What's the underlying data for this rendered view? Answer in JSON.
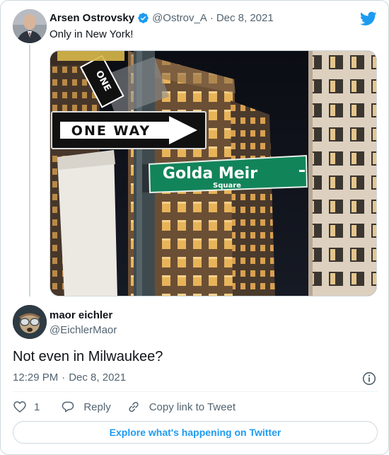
{
  "quoted_tweet": {
    "author_name": "Arsen Ostrovsky",
    "handle": "@Ostrov_A",
    "separator": "·",
    "date": "Dec 8, 2021",
    "text": "Only in New York!",
    "photo": {
      "sign_one_way": "ONE WAY",
      "sign_one_vertical": "ONE",
      "street_sign_main": "Golda Meir",
      "street_sign_sub": "Square"
    }
  },
  "reply_tweet": {
    "author_name": "maor eichler",
    "handle": "@EichlerMaor",
    "text": "Not even in Milwaukee?",
    "time": "12:29 PM",
    "separator": "·",
    "date": "Dec 8, 2021"
  },
  "actions": {
    "like_count": "1",
    "reply_label": "Reply",
    "copy_link_label": "Copy link to Tweet"
  },
  "explore_label": "Explore what's happening on Twitter",
  "colors": {
    "brand_blue": "#1d9bf0",
    "text_primary": "#0f1419",
    "text_secondary": "#536471",
    "street_sign_green": "#12845a"
  }
}
